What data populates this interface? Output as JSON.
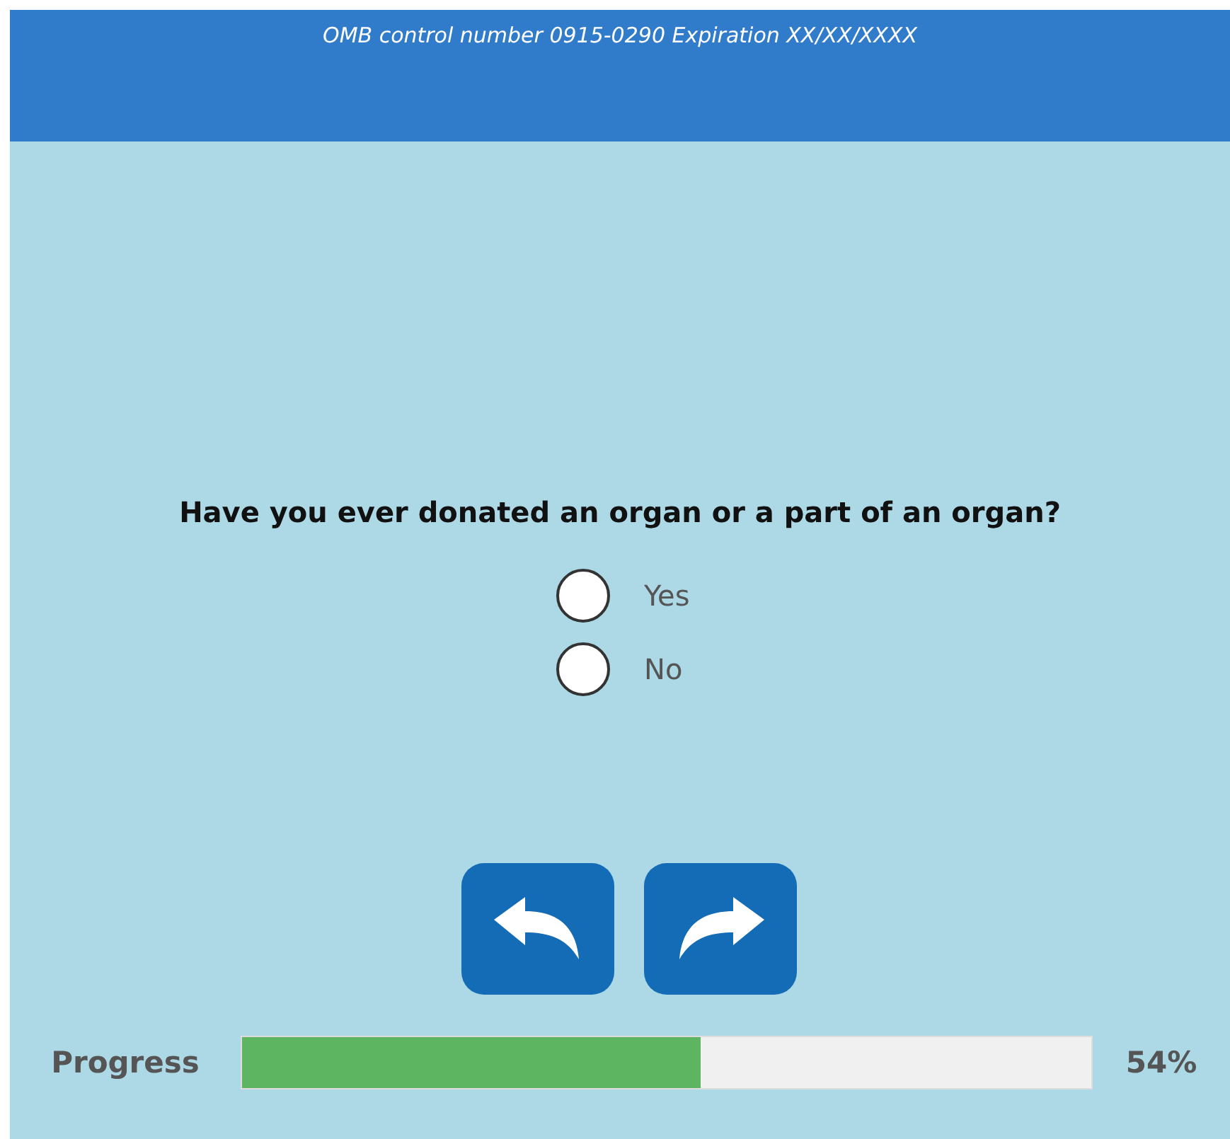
{
  "header": {
    "text": "OMB control number 0915-0290 Expiration XX/XX/XXXX"
  },
  "question": "Have you ever donated an organ or a part of an organ?",
  "options": [
    {
      "label": "Yes",
      "selected": false
    },
    {
      "label": "No",
      "selected": false
    }
  ],
  "progress": {
    "label": "Progress",
    "level": 0.54,
    "reading": "54%"
  }
}
